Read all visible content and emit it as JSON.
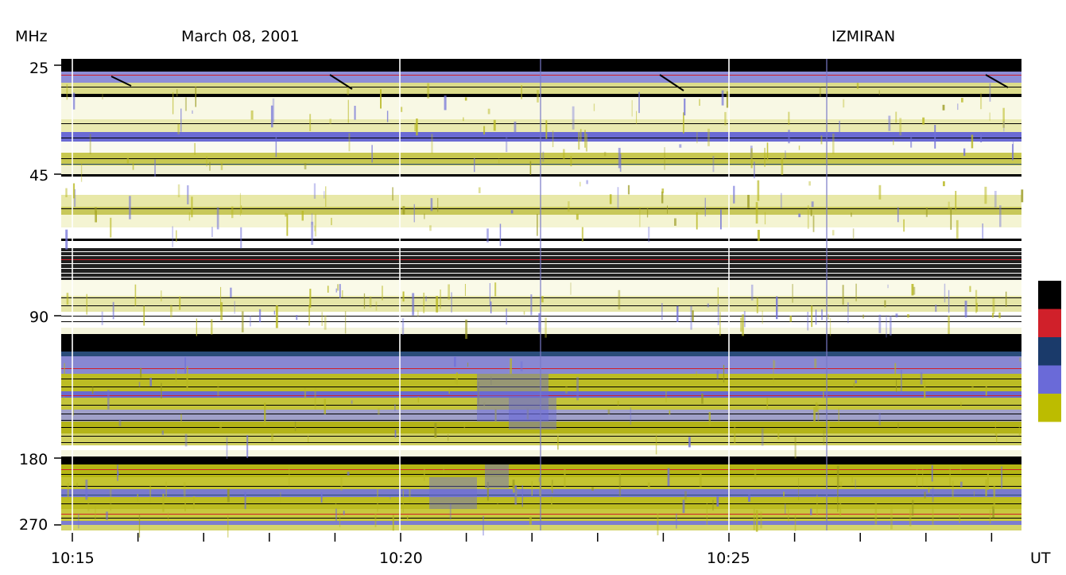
{
  "header": {
    "unit_label": "MHz",
    "date": "March 08, 2001",
    "observatory": "IZMIRAN"
  },
  "chart_data": {
    "type": "heatmap",
    "title": "March 08, 2001",
    "source": "IZMIRAN",
    "ylabel": "MHz",
    "xlabel": "UT",
    "y_ticks": [
      "25",
      "45",
      "90",
      "180",
      "270"
    ],
    "x_ticks": [
      "10:15",
      "10:20",
      "10:25"
    ],
    "x_range": [
      "10:15",
      "10:29:30"
    ],
    "y_range_mhz": [
      25,
      270
    ],
    "scale": "log",
    "colorbar": {
      "placement": "right",
      "colors": [
        "#ffffff",
        "#bcbc00",
        "#6a6ad8",
        "#1a3a6a",
        "#d0202a",
        "#000000"
      ]
    }
  }
}
